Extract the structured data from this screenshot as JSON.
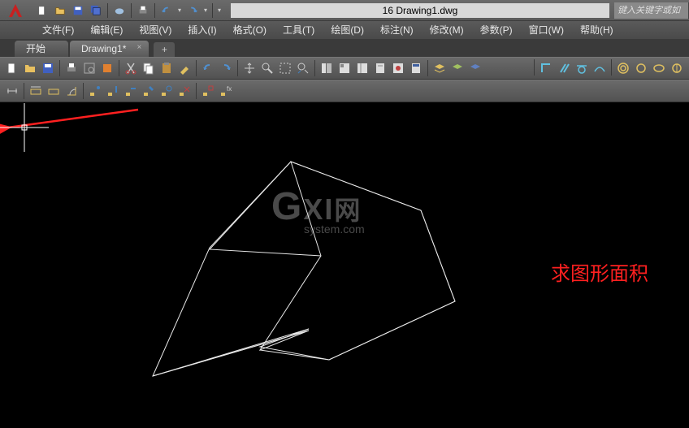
{
  "title": "16   Drawing1.dwg",
  "search_placeholder": "键入关键字或如",
  "menus": {
    "file": "文件(F)",
    "edit": "编辑(E)",
    "view": "视图(V)",
    "insert": "插入(I)",
    "format": "格式(O)",
    "tools": "工具(T)",
    "draw": "绘图(D)",
    "dimension": "标注(N)",
    "modify": "修改(M)",
    "parametric": "参数(P)",
    "window": "窗口(W)",
    "help": "帮助(H)"
  },
  "tabs": {
    "start": "开始",
    "drawing": "Drawing1*"
  },
  "watermark": {
    "main": "GXI网",
    "sub": "system.com"
  },
  "annotation": "求图形面积",
  "icons": {
    "new": "new-doc",
    "open": "open",
    "save": "save",
    "saveall": "saveall",
    "print": "print",
    "undo": "undo",
    "redo": "redo"
  }
}
